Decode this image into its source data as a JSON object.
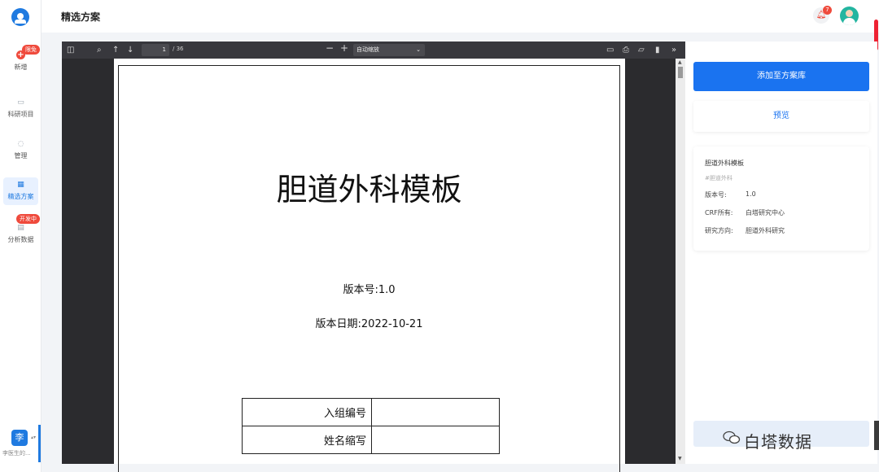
{
  "sidebar": {
    "items": [
      {
        "label": "新增",
        "icon": "plus-icon",
        "badge": "限免"
      },
      {
        "label": "科研项目",
        "icon": "folder-icon"
      },
      {
        "label": "管理",
        "icon": "person-icon"
      },
      {
        "label": "精选方案",
        "icon": "grid-icon"
      },
      {
        "label": "分析数据",
        "icon": "chart-icon",
        "badge": "开发中"
      }
    ],
    "user": {
      "avatar_char": "李",
      "name": "李医生的..."
    }
  },
  "header": {
    "title": "精选方案",
    "notification_count": "7"
  },
  "viewer": {
    "page_current": "1",
    "page_total": "/ 36",
    "zoom": "自动缩放"
  },
  "document": {
    "title": "胆道外科模板",
    "version": "版本号:1.0",
    "date": "版本日期:2022-10-21",
    "table_rows": [
      {
        "label": "入组编号",
        "value": ""
      },
      {
        "label": "姓名缩写",
        "value": ""
      }
    ]
  },
  "panel": {
    "add_button": "添加至方案库",
    "preview_button": "预览",
    "info": {
      "name": "胆道外科模板",
      "tag": "#胆道外科",
      "rows": [
        {
          "k": "版本号:",
          "v": "1.0"
        },
        {
          "k": "CRF所有:",
          "v": "白塔研究中心"
        },
        {
          "k": "研究方向:",
          "v": "胆道外科研究"
        }
      ]
    },
    "watermark": "白塔数据"
  },
  "colors": {
    "primary": "#1a73f0",
    "badge": "#ef4a3c"
  }
}
